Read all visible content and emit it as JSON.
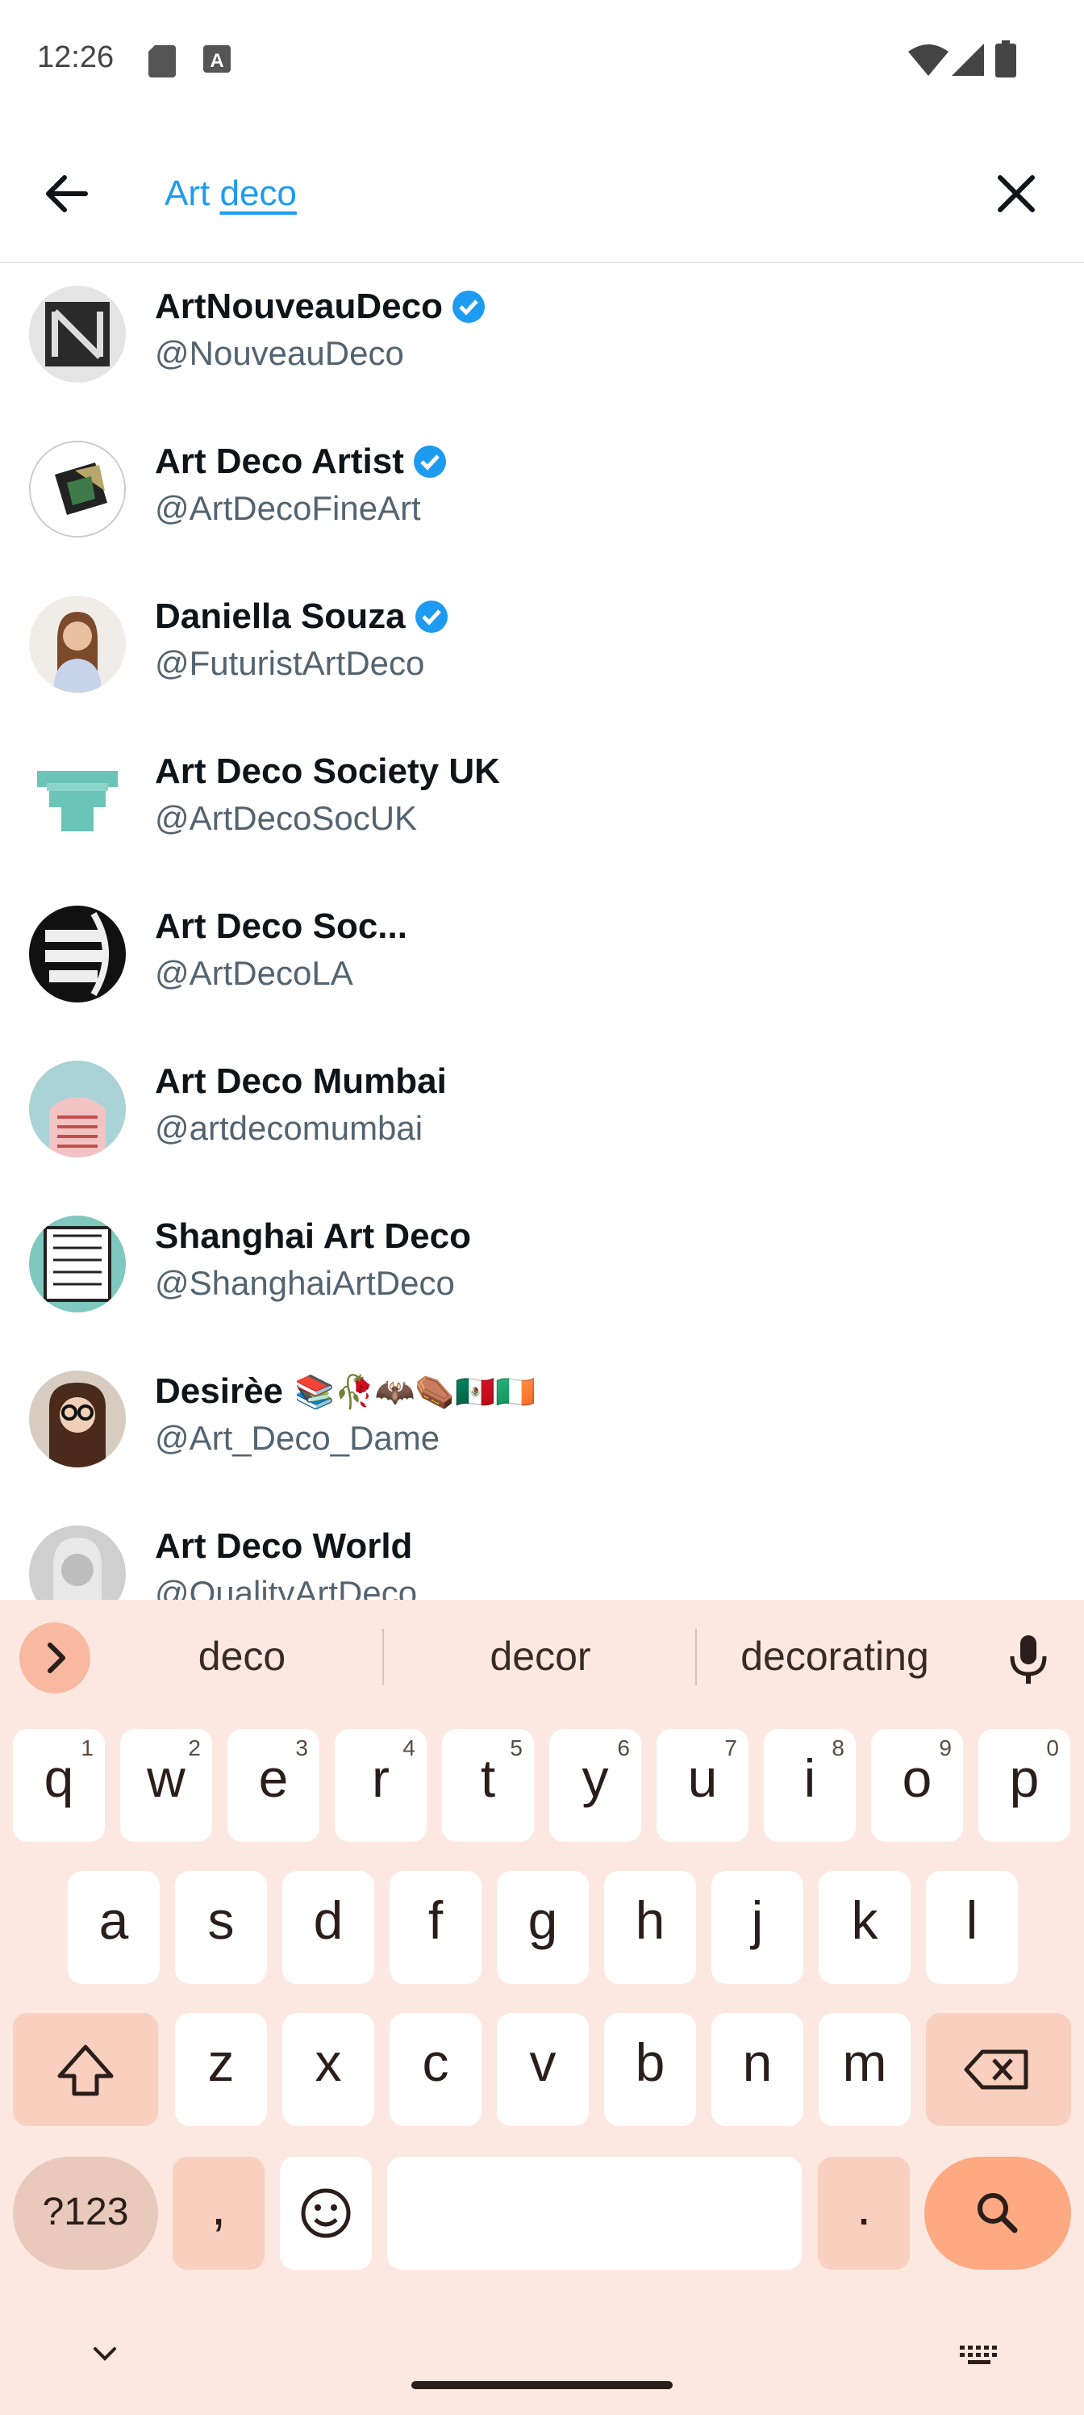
{
  "status_bar": {
    "time": "12:26",
    "icons": [
      "sd-card-icon",
      "text-a-icon",
      "wifi-icon",
      "signal-icon",
      "battery-icon"
    ]
  },
  "search": {
    "query_word1": "Art",
    "query_word2": "deco",
    "back_icon": "arrow-left-icon",
    "clear_icon": "close-icon"
  },
  "results": [
    {
      "name": "ArtNouveauDeco",
      "handle": "@NouveauDeco",
      "verified": true,
      "emojis": ""
    },
    {
      "name": "Art Deco Artist",
      "handle": "@ArtDecoFineArt",
      "verified": true,
      "emojis": ""
    },
    {
      "name": "Daniella Souza",
      "handle": "@FuturistArtDeco",
      "verified": true,
      "emojis": ""
    },
    {
      "name": "Art Deco Society UK",
      "handle": "@ArtDecoSocUK",
      "verified": false,
      "emojis": ""
    },
    {
      "name": "Art Deco Soc...",
      "handle": "@ArtDecoLA",
      "verified": false,
      "emojis": ""
    },
    {
      "name": "Art Deco Mumbai",
      "handle": "@artdecomumbai",
      "verified": false,
      "emojis": ""
    },
    {
      "name": "Shanghai Art Deco",
      "handle": "@ShanghaiArtDeco",
      "verified": false,
      "emojis": ""
    },
    {
      "name": "Desirèe",
      "handle": "@Art_Deco_Dame",
      "verified": false,
      "emojis": "📚🥀🦇⚰️🇲🇽🇮🇪"
    },
    {
      "name": "Art Deco World",
      "handle": "@QualityArtDeco",
      "verified": false,
      "emojis": ""
    }
  ],
  "keyboard": {
    "suggestions": [
      "deco",
      "decor",
      "decorating"
    ],
    "row1": [
      {
        "k": "q",
        "h": "1"
      },
      {
        "k": "w",
        "h": "2"
      },
      {
        "k": "e",
        "h": "3"
      },
      {
        "k": "r",
        "h": "4"
      },
      {
        "k": "t",
        "h": "5"
      },
      {
        "k": "y",
        "h": "6"
      },
      {
        "k": "u",
        "h": "7"
      },
      {
        "k": "i",
        "h": "8"
      },
      {
        "k": "o",
        "h": "9"
      },
      {
        "k": "p",
        "h": "0"
      }
    ],
    "row2": [
      "a",
      "s",
      "d",
      "f",
      "g",
      "h",
      "j",
      "k",
      "l"
    ],
    "row3": [
      "z",
      "x",
      "c",
      "v",
      "b",
      "n",
      "m"
    ],
    "symbols_label": "?123",
    "comma_label": ",",
    "period_label": "."
  },
  "colors": {
    "accent": "#1d9bf0",
    "keyboard_bg": "#fce8e0",
    "search_key": "#fda982"
  }
}
